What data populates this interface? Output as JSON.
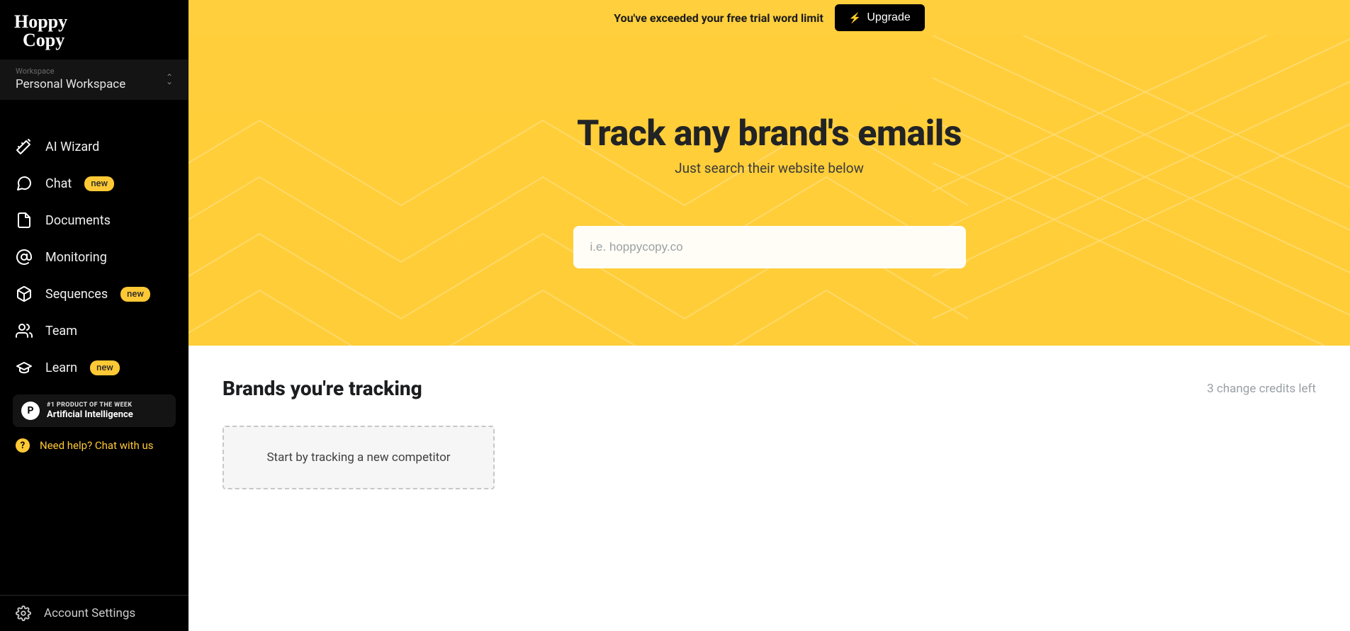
{
  "brand": {
    "name": "Hoppy Copy"
  },
  "workspace": {
    "label": "Workspace",
    "name": "Personal Workspace"
  },
  "nav": {
    "ai_wizard": "AI Wizard",
    "chat": "Chat",
    "documents": "Documents",
    "monitoring": "Monitoring",
    "sequences": "Sequences",
    "team": "Team",
    "learn": "Learn",
    "badge_new": "new"
  },
  "promo": {
    "line1": "#1 PRODUCT OF THE WEEK",
    "line2": "Artificial Intelligence",
    "badge": "P"
  },
  "help": {
    "text": "Need help? Chat with us",
    "q": "?"
  },
  "settings": {
    "label": "Account Settings"
  },
  "trial": {
    "message": "You've exceeded your free trial word limit",
    "upgrade": "Upgrade"
  },
  "hero": {
    "title": "Track any brand's emails",
    "subtitle": "Just search their website below",
    "placeholder": "i.e. hoppycopy.co"
  },
  "tracking": {
    "heading": "Brands you're tracking",
    "credits": "3 change credits left",
    "empty_card": "Start by tracking a new competitor"
  }
}
